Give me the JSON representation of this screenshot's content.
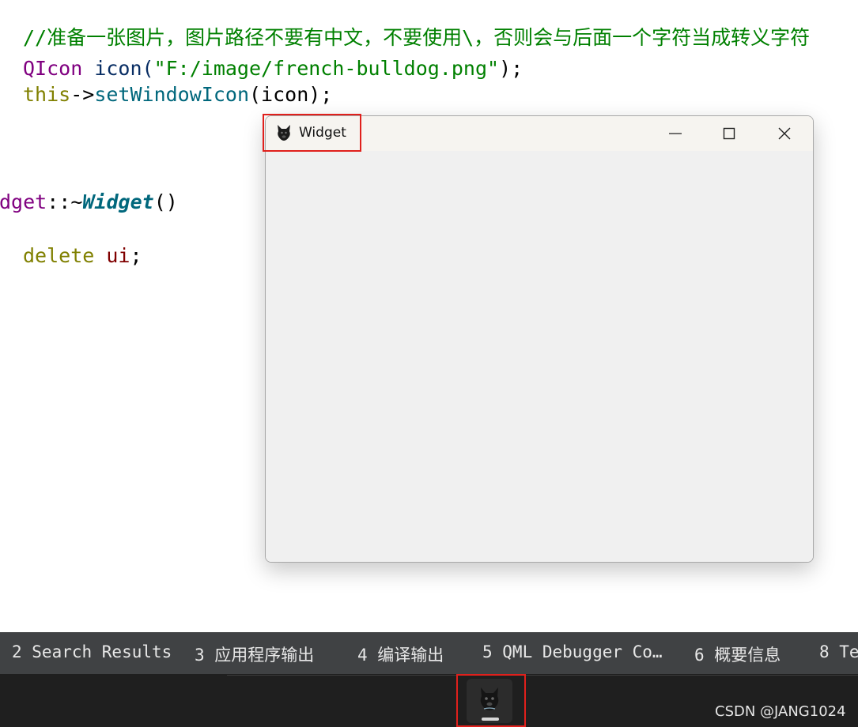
{
  "code": {
    "comment": "//准备一张图片，图片路径不要有中文，不要使用\\，否则会与后面一个字符当成转义字符",
    "line2": {
      "type": "QIcon",
      "var": " icon(",
      "str": "\"F:/image/french-bulldog.png\"",
      "end": ");"
    },
    "line3": {
      "kw": "this",
      "arrow": "->",
      "func": "setWindowIcon",
      "args": "(icon);"
    },
    "line4": {
      "class": "dget",
      "sep": "::~",
      "dtor": "Widget",
      "end": "()"
    },
    "line5": {
      "kw": "delete",
      "var": " ui",
      "end": ";"
    }
  },
  "window": {
    "title": "Widget",
    "icon": "french-bulldog-icon",
    "controls": [
      "minimize-icon",
      "maximize-icon",
      "close-icon"
    ]
  },
  "panel_tabs": [
    {
      "label": "2 Search Results"
    },
    {
      "label": "3 应用程序输出"
    },
    {
      "label": "4 编译输出"
    },
    {
      "label": "5 QML Debugger Co…"
    },
    {
      "label": "6 概要信息"
    },
    {
      "label": "8 Te"
    }
  ],
  "taskbar": {
    "app_icon": "french-bulldog-icon"
  },
  "watermark": "CSDN @JANG1024",
  "colors": {
    "highlight": "#e0201c",
    "comment": "#008000",
    "panel": "#404244",
    "taskbar": "#1f1f1f"
  }
}
